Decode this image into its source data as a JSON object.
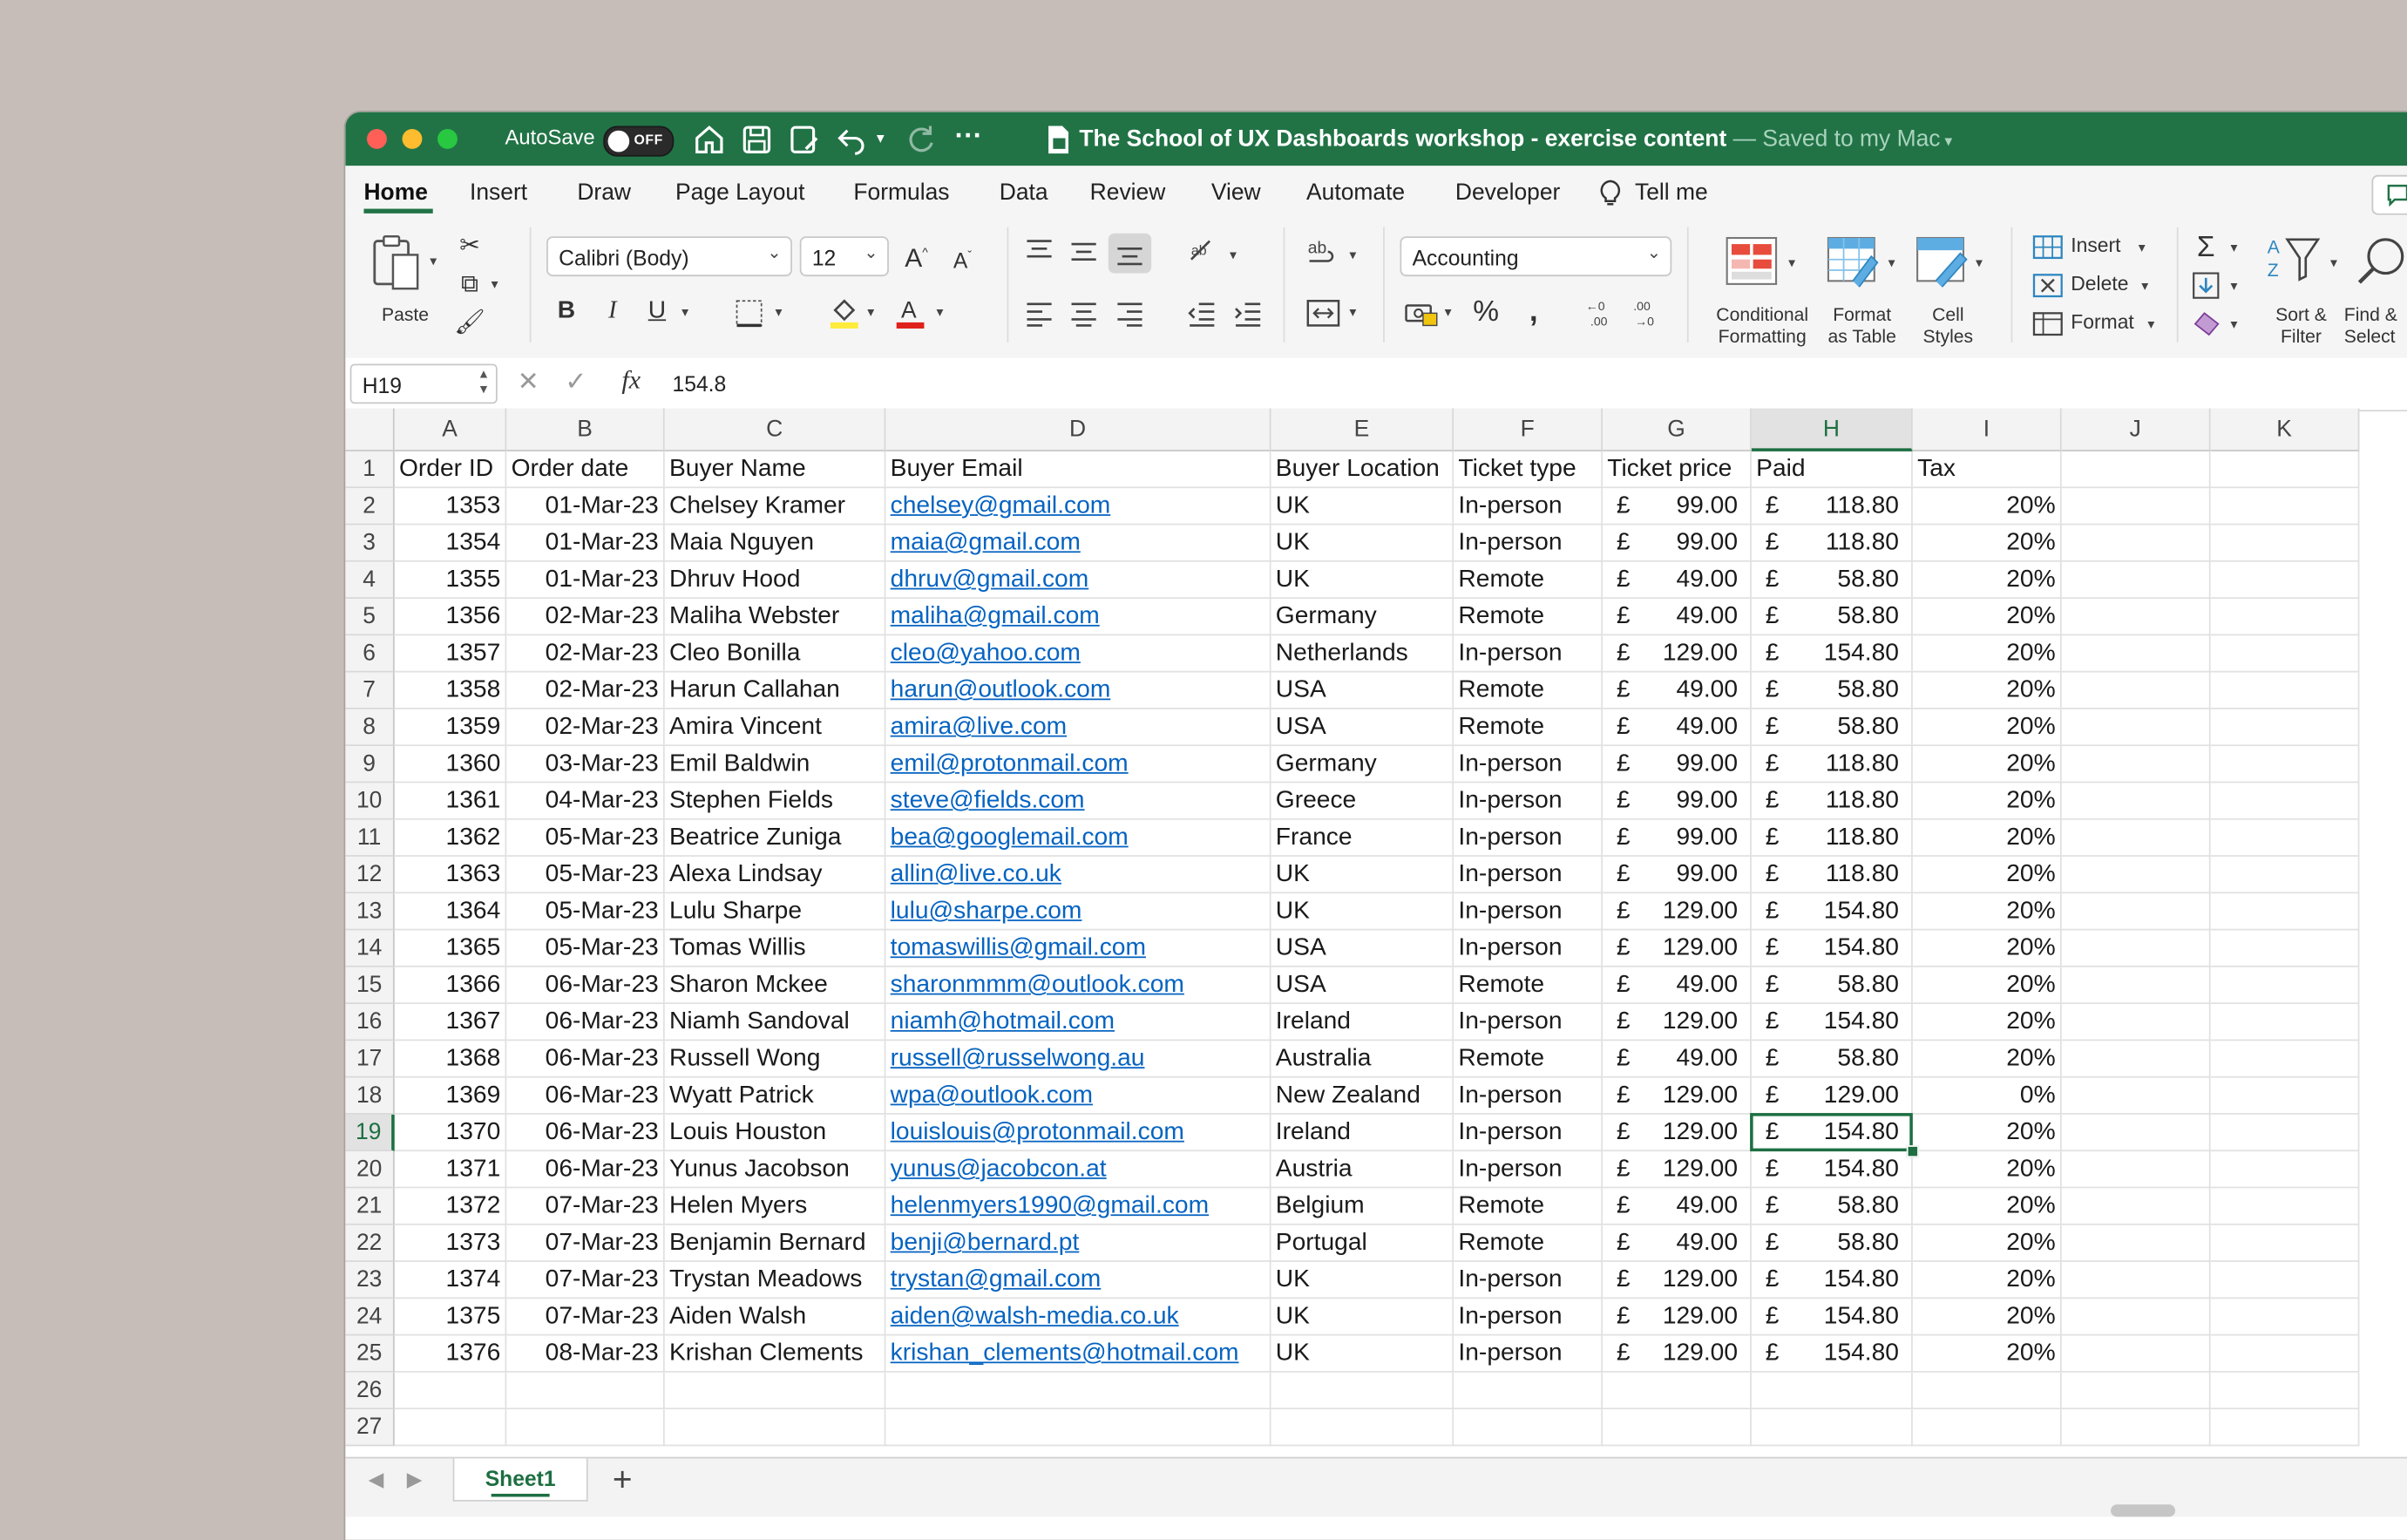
{
  "titlebar": {
    "autosave_label": "AutoSave",
    "autosave_state": "OFF",
    "doc_title": "The School of UX Dashboards workshop - exercise content",
    "saved_status": " — Saved to my Mac",
    "accent": "#217346"
  },
  "tabs": [
    "Home",
    "Insert",
    "Draw",
    "Page Layout",
    "Formulas",
    "Data",
    "Review",
    "View",
    "Automate",
    "Developer",
    "Tell me"
  ],
  "ribbon": {
    "paste": "Paste",
    "font_name": "Calibri (Body)",
    "font_size": "12",
    "number_format": "Accounting",
    "conditional_formatting": [
      "Conditional",
      "Formatting"
    ],
    "format_as_table": [
      "Format",
      "as Table"
    ],
    "cell_styles": [
      "Cell",
      "Styles"
    ],
    "insert": "Insert",
    "delete": "Delete",
    "format": "Format",
    "sort_filter": [
      "Sort &",
      "Filter"
    ],
    "find_select": [
      "Find &",
      "Select"
    ]
  },
  "formula_bar": {
    "name_box": "H19",
    "fx": "fx",
    "formula": "154.8"
  },
  "sheet": {
    "columns": [
      "A",
      "B",
      "C",
      "D",
      "E",
      "F",
      "G",
      "H",
      "I",
      "J",
      "K"
    ],
    "selected_column": "H",
    "selected_row": 19,
    "header_row": [
      "Order ID",
      "Order date",
      "Buyer Name",
      "Buyer Email",
      "Buyer Location",
      "Ticket type",
      "Ticket price",
      "Paid",
      "Tax"
    ],
    "currency_symbol": "£",
    "rows": [
      {
        "id": "1353",
        "date": "01-Mar-23",
        "name": "Chelsey Kramer",
        "email": "chelsey@gmail.com",
        "location": "UK",
        "type": "In-person",
        "price": "99.00",
        "paid": "118.80",
        "tax": "20%"
      },
      {
        "id": "1354",
        "date": "01-Mar-23",
        "name": "Maia Nguyen",
        "email": "maia@gmail.com",
        "location": "UK",
        "type": "In-person",
        "price": "99.00",
        "paid": "118.80",
        "tax": "20%"
      },
      {
        "id": "1355",
        "date": "01-Mar-23",
        "name": "Dhruv Hood",
        "email": "dhruv@gmail.com",
        "location": "UK",
        "type": "Remote",
        "price": "49.00",
        "paid": "58.80",
        "tax": "20%"
      },
      {
        "id": "1356",
        "date": "02-Mar-23",
        "name": "Maliha Webster",
        "email": "maliha@gmail.com",
        "location": "Germany",
        "type": "Remote",
        "price": "49.00",
        "paid": "58.80",
        "tax": "20%"
      },
      {
        "id": "1357",
        "date": "02-Mar-23",
        "name": "Cleo Bonilla",
        "email": "cleo@yahoo.com",
        "location": "Netherlands",
        "type": "In-person",
        "price": "129.00",
        "paid": "154.80",
        "tax": "20%"
      },
      {
        "id": "1358",
        "date": "02-Mar-23",
        "name": "Harun Callahan",
        "email": "harun@outlook.com",
        "location": "USA",
        "type": "Remote",
        "price": "49.00",
        "paid": "58.80",
        "tax": "20%"
      },
      {
        "id": "1359",
        "date": "02-Mar-23",
        "name": "Amira Vincent",
        "email": "amira@live.com",
        "location": "USA",
        "type": "Remote",
        "price": "49.00",
        "paid": "58.80",
        "tax": "20%"
      },
      {
        "id": "1360",
        "date": "03-Mar-23",
        "name": "Emil Baldwin",
        "email": "emil@protonmail.com",
        "location": "Germany",
        "type": "In-person",
        "price": "99.00",
        "paid": "118.80",
        "tax": "20%"
      },
      {
        "id": "1361",
        "date": "04-Mar-23",
        "name": "Stephen Fields",
        "email": "steve@fields.com",
        "location": "Greece",
        "type": "In-person",
        "price": "99.00",
        "paid": "118.80",
        "tax": "20%"
      },
      {
        "id": "1362",
        "date": "05-Mar-23",
        "name": "Beatrice Zuniga",
        "email": "bea@googlemail.com",
        "location": "France",
        "type": "In-person",
        "price": "99.00",
        "paid": "118.80",
        "tax": "20%"
      },
      {
        "id": "1363",
        "date": "05-Mar-23",
        "name": "Alexa Lindsay",
        "email": "allin@live.co.uk",
        "location": "UK",
        "type": "In-person",
        "price": "99.00",
        "paid": "118.80",
        "tax": "20%"
      },
      {
        "id": "1364",
        "date": "05-Mar-23",
        "name": "Lulu Sharpe",
        "email": "lulu@sharpe.com",
        "location": "UK",
        "type": "In-person",
        "price": "129.00",
        "paid": "154.80",
        "tax": "20%"
      },
      {
        "id": "1365",
        "date": "05-Mar-23",
        "name": "Tomas Willis",
        "email": "tomaswillis@gmail.com",
        "location": "USA",
        "type": "In-person",
        "price": "129.00",
        "paid": "154.80",
        "tax": "20%"
      },
      {
        "id": "1366",
        "date": "06-Mar-23",
        "name": "Sharon Mckee",
        "email": "sharonmmm@outlook.com",
        "location": "USA",
        "type": "Remote",
        "price": "49.00",
        "paid": "58.80",
        "tax": "20%"
      },
      {
        "id": "1367",
        "date": "06-Mar-23",
        "name": "Niamh Sandoval",
        "email": "niamh@hotmail.com",
        "location": "Ireland",
        "type": "In-person",
        "price": "129.00",
        "paid": "154.80",
        "tax": "20%"
      },
      {
        "id": "1368",
        "date": "06-Mar-23",
        "name": "Russell Wong",
        "email": "russell@russelwong.au",
        "location": "Australia",
        "type": "Remote",
        "price": "49.00",
        "paid": "58.80",
        "tax": "20%"
      },
      {
        "id": "1369",
        "date": "06-Mar-23",
        "name": "Wyatt Patrick",
        "email": "wpa@outlook.com",
        "location": "New Zealand",
        "type": "In-person",
        "price": "129.00",
        "paid": "129.00",
        "tax": "0%"
      },
      {
        "id": "1370",
        "date": "06-Mar-23",
        "name": "Louis Houston",
        "email": "louislouis@protonmail.com",
        "location": "Ireland",
        "type": "In-person",
        "price": "129.00",
        "paid": "154.80",
        "tax": "20%"
      },
      {
        "id": "1371",
        "date": "06-Mar-23",
        "name": "Yunus Jacobson",
        "email": "yunus@jacobcon.at",
        "location": "Austria",
        "type": "In-person",
        "price": "129.00",
        "paid": "154.80",
        "tax": "20%"
      },
      {
        "id": "1372",
        "date": "07-Mar-23",
        "name": "Helen Myers",
        "email": "helenmyers1990@gmail.com",
        "location": "Belgium",
        "type": "Remote",
        "price": "49.00",
        "paid": "58.80",
        "tax": "20%"
      },
      {
        "id": "1373",
        "date": "07-Mar-23",
        "name": "Benjamin Bernard",
        "email": "benji@bernard.pt",
        "location": "Portugal",
        "type": "Remote",
        "price": "49.00",
        "paid": "58.80",
        "tax": "20%"
      },
      {
        "id": "1374",
        "date": "07-Mar-23",
        "name": "Trystan Meadows",
        "email": "trystan@gmail.com",
        "location": "UK",
        "type": "In-person",
        "price": "129.00",
        "paid": "154.80",
        "tax": "20%"
      },
      {
        "id": "1375",
        "date": "07-Mar-23",
        "name": "Aiden Walsh",
        "email": "aiden@walsh-media.co.uk",
        "location": "UK",
        "type": "In-person",
        "price": "129.00",
        "paid": "154.80",
        "tax": "20%"
      },
      {
        "id": "1376",
        "date": "08-Mar-23",
        "name": "Krishan Clements",
        "email": "krishan_clements@hotmail.com",
        "location": "UK",
        "type": "In-person",
        "price": "129.00",
        "paid": "154.80",
        "tax": "20%"
      }
    ],
    "row_numbers": [
      "1",
      "2",
      "3",
      "4",
      "5",
      "6",
      "7",
      "8",
      "9",
      "10",
      "11",
      "12",
      "13",
      "14",
      "15",
      "16",
      "17",
      "18",
      "19",
      "20",
      "21",
      "22",
      "23",
      "24",
      "25",
      "26",
      "27"
    ]
  },
  "sheet_tabs": {
    "active": "Sheet1",
    "add": "+"
  }
}
